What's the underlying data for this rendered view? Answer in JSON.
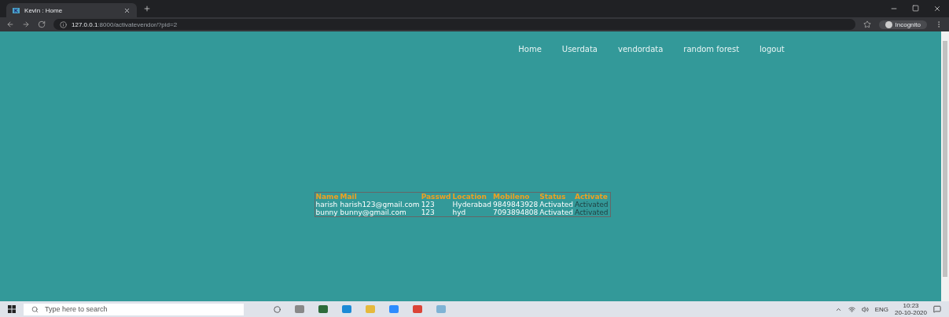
{
  "browser": {
    "tab_title": "Kevin : Home",
    "tab_favicon": "K",
    "url_host": "127.0.0.1",
    "url_rest": ":8000/activatevendor/?pid=2",
    "profile": "Incognito"
  },
  "nav": [
    {
      "label": "Home"
    },
    {
      "label": "Userdata"
    },
    {
      "label": "vendordata"
    },
    {
      "label": "random forest"
    },
    {
      "label": "logout"
    }
  ],
  "table": {
    "columns": [
      "Name",
      "Mail",
      "Passwd",
      "Location",
      "Mobileno",
      "Status",
      "Activate"
    ],
    "rows": [
      [
        "harish",
        "harish123@gmail.com",
        "123",
        "Hyderabad",
        "9849843928",
        "Activated",
        "Activated"
      ],
      [
        "bunny",
        "bunny@gmail.com",
        "123",
        "hyd",
        "7093894808",
        "Activated",
        "Activated"
      ]
    ]
  },
  "taskbar": {
    "search_placeholder": "Type here to search",
    "language": "ENG",
    "time": "10:23",
    "date": "20-10-2020"
  }
}
